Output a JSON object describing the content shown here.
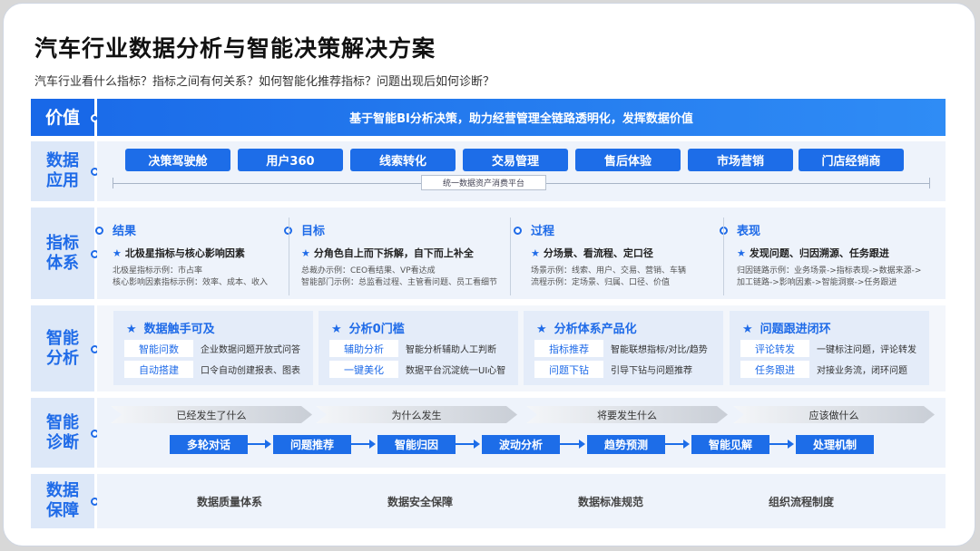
{
  "title": "汽车行业数据分析与智能决策解决方案",
  "subtitle": "汽车行业看什么指标？指标之间有何关系？如何智能化推荐指标？问题出现后如何诊断？",
  "rows": {
    "value": {
      "label": "价值",
      "text": "基于智能BI分析决策，助力经营管理全链路透明化，发挥数据价值"
    },
    "apps": {
      "label": "数据\n应用",
      "items": [
        "决策驾驶舱",
        "用户360",
        "线索转化",
        "交易管理",
        "售后体验",
        "市场营销",
        "门店经销商"
      ],
      "platform": "统一数据资产消费平台"
    },
    "metrics": {
      "label": "指标\n体系",
      "columns": [
        {
          "title": "结果",
          "star": "北极星指标与核心影响因素",
          "lines": [
            "北极星指标示例：市占率",
            "核心影响因素指标示例：效率、成本、收入"
          ]
        },
        {
          "title": "目标",
          "star": "分角色自上而下拆解，自下而上补全",
          "lines": [
            "总裁办示例：CEO看结果、VP看达成",
            "智能部门示例：总监看过程、主管看问题、员工看细节"
          ]
        },
        {
          "title": "过程",
          "star": "分场景、看流程、定口径",
          "lines": [
            "场景示例：线索、用户、交易、营销、车辆",
            "流程示例：定场景、归属、口径、价值"
          ]
        },
        {
          "title": "表现",
          "star": "发现问题、归因溯源、任务跟进",
          "lines": [
            "归因链路示例：业务场景->指标表现->数据来源->",
            "加工链路->影响因素->智能洞察->任务跟进"
          ]
        }
      ]
    },
    "analysis": {
      "label": "智能\n分析",
      "panels": [
        {
          "title": "数据触手可及",
          "items": [
            {
              "tag": "智能问数",
              "desc": "企业数据问题开放式问答"
            },
            {
              "tag": "自动搭建",
              "desc": "口令自动创建报表、图表"
            }
          ]
        },
        {
          "title": "分析0门槛",
          "items": [
            {
              "tag": "辅助分析",
              "desc": "智能分析辅助人工判断"
            },
            {
              "tag": "一键美化",
              "desc": "数据平台沉淀统一UI心智"
            }
          ]
        },
        {
          "title": "分析体系产品化",
          "items": [
            {
              "tag": "指标推荐",
              "desc": "智能联想指标/对比/趋势"
            },
            {
              "tag": "问题下钻",
              "desc": "引导下钻与问题推荐"
            }
          ]
        },
        {
          "title": "问题跟进闭环",
          "items": [
            {
              "tag": "评论转发",
              "desc": "一键标注问题，评论转发"
            },
            {
              "tag": "任务跟进",
              "desc": "对接业务流，闭环问题"
            }
          ]
        }
      ]
    },
    "diagnosis": {
      "label": "智能\n诊断",
      "stages": [
        "已经发生了什么",
        "为什么发生",
        "将要发生什么",
        "应该做什么"
      ],
      "steps": [
        "多轮对话",
        "问题推荐",
        "智能归因",
        "波动分析",
        "趋势预测",
        "智能见解",
        "处理机制"
      ]
    },
    "guarantee": {
      "label": "数据\n保障",
      "items": [
        "数据质量体系",
        "数据安全保障",
        "数据标准规范",
        "组织流程制度"
      ]
    }
  },
  "colors": {
    "accent": "#1d6de8",
    "label_bg": "#dde8f8",
    "body_bg": "#eef3fb"
  },
  "icons": {
    "star": "★",
    "dot": "circle-dot-icon"
  }
}
